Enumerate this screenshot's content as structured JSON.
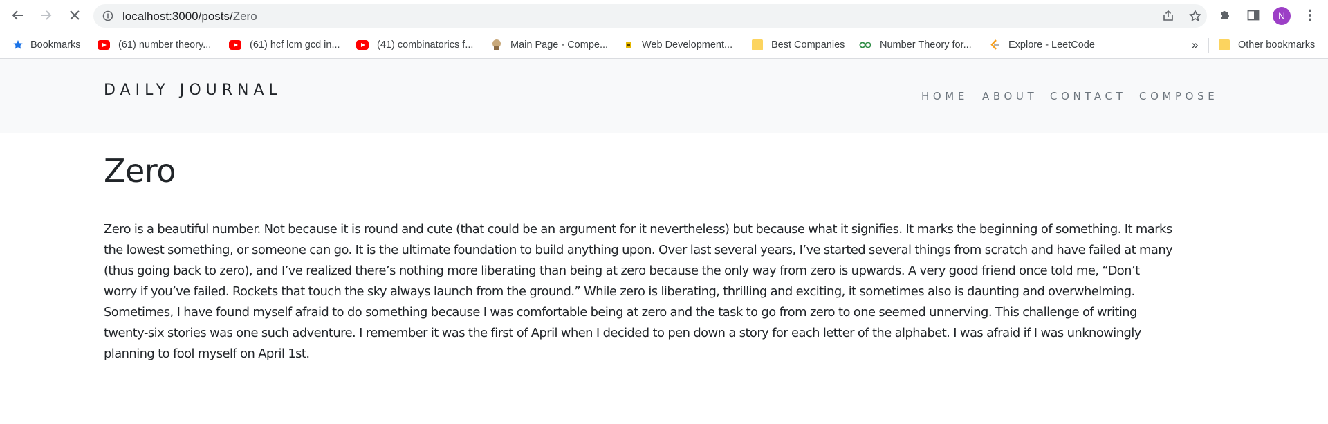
{
  "browser": {
    "url_host": "localhost:3000/posts/",
    "url_path": "Zero",
    "profile_initial": "N",
    "bookmarks": [
      {
        "label": "Bookmarks",
        "icon": "star-icon"
      },
      {
        "label": "(61) number theory...",
        "icon": "youtube-icon"
      },
      {
        "label": "(61) hcf lcm gcd in...",
        "icon": "youtube-icon"
      },
      {
        "label": "(41) combinatorics f...",
        "icon": "youtube-icon"
      },
      {
        "label": "Main Page - Compe...",
        "icon": "site-icon"
      },
      {
        "label": "Web Development...",
        "icon": "site-icon"
      },
      {
        "label": "Best Companies",
        "icon": "folder-icon"
      },
      {
        "label": "Number Theory for...",
        "icon": "geeksforgeeks-icon"
      },
      {
        "label": "Explore - LeetCode",
        "icon": "leetcode-icon"
      }
    ],
    "overflow_label": "»",
    "other_bookmarks": "Other bookmarks"
  },
  "site": {
    "brand": "DAILY JOURNAL",
    "nav": [
      "HOME",
      "ABOUT",
      "CONTACT",
      "COMPOSE"
    ]
  },
  "post": {
    "title": "Zero",
    "lines": [
      "Zero is a beautiful number. Not because it is round and cute (that could be an argument for it nevertheless) but because what it signifies. It marks the beginning of something. It marks",
      "the lowest something, or someone can go. It is the ultimate foundation to build anything upon. Over last several years, I’ve started several things from scratch and have failed at many",
      "(thus going back to zero), and I’ve realized there’s nothing more liberating than being at zero because the only way from zero is upwards. A very good friend once told me, “Don’t",
      "worry if you’ve failed. Rockets that touch the sky always launch from the ground.” While zero is liberating, thrilling and exciting, it sometimes also is daunting and overwhelming.",
      "Sometimes, I have found myself afraid to do something because I was comfortable being at zero and the task to go from zero to one seemed unnerving. This challenge of writing",
      "twenty-six stories was one such adventure. I remember it was the first of April when I decided to pen down a story for each letter of the alphabet. I was afraid if I was unknowingly",
      "planning to fool myself on April 1st."
    ]
  }
}
